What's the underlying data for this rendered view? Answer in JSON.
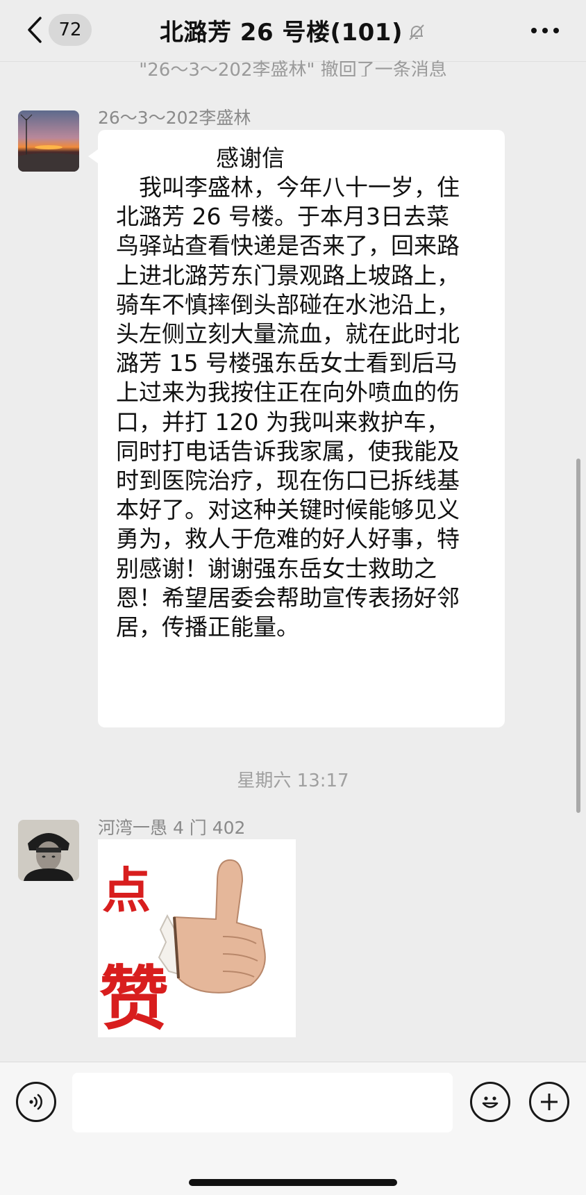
{
  "header": {
    "unread_count": "72",
    "title": "北潞芳 26 号楼(101)"
  },
  "recall_notice": "\"26～3～202李盛林\" 撤回了一条消息",
  "messages": [
    {
      "sender": "26～3～202李盛林",
      "letter_title": "感谢信",
      "letter_body": "　我叫李盛林，今年八十一岁，住北潞芳 26 号楼。于本月3日去菜鸟驿站查看快递是否来了，回来路上进北潞芳东门景观路上坡路上，骑车不慎摔倒头部碰在水池沿上，头左侧立刻大量流血，就在此时北潞芳 15 号楼强东岳女士看到后马上过来为我按住正在向外喷血的伤口，并打 120 为我叫来救护车，同时打电话告诉我家属，使我能及时到医院治疗，现在伤口已拆线基本好了。对这种关键时候能够见义勇为，救人于危难的好人好事，特别感谢！谢谢强东岳女士救助之恩！希望居委会帮助宣传表扬好邻居，传播正能量。"
    },
    {
      "sender": "河湾一愚 4 门 402",
      "sticker_chars": [
        "点",
        "赞"
      ]
    }
  ],
  "timestamp": "星期六 13:17",
  "input": {
    "placeholder": ""
  },
  "icons": {
    "back": "chevron-left-icon",
    "mute": "bell-slash-icon",
    "more": "more-dots-icon",
    "voice": "voice-icon",
    "emoji": "emoji-icon",
    "plus": "plus-icon"
  }
}
